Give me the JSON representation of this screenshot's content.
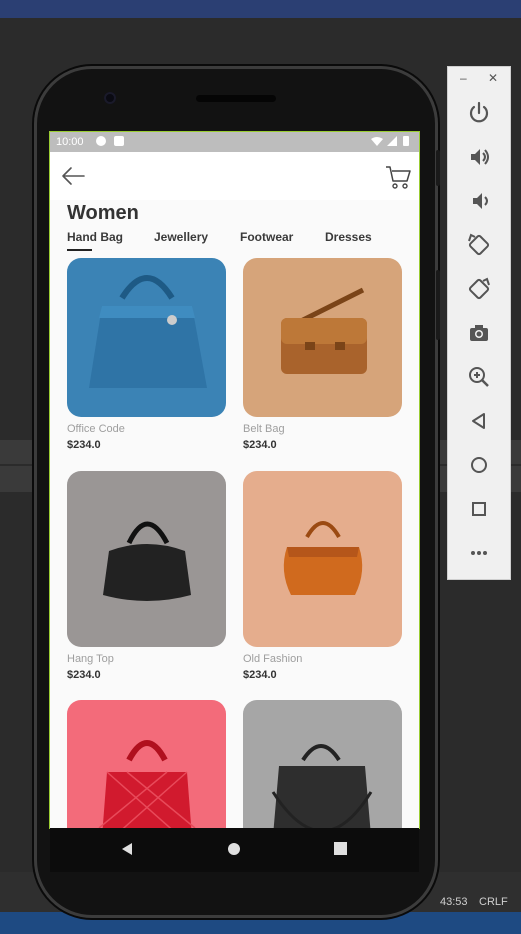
{
  "ide": {
    "status_position": "43:53",
    "status_eol": "CRLF"
  },
  "device": {
    "status_bar": {
      "time": "10:00"
    }
  },
  "app": {
    "title": "Women",
    "tabs": [
      {
        "label": "Hand Bag",
        "selected": true
      },
      {
        "label": "Jewellery",
        "selected": false
      },
      {
        "label": "Footwear",
        "selected": false
      },
      {
        "label": "Dresses",
        "selected": false
      }
    ],
    "products": [
      {
        "name": "Office Code",
        "price": "$234.0",
        "bg": "#3b83b5"
      },
      {
        "name": "Belt Bag",
        "price": "$234.0",
        "bg": "#d6a47a"
      },
      {
        "name": "Hang Top",
        "price": "$234.0",
        "bg": "#9a9695"
      },
      {
        "name": "Old Fashion",
        "price": "$234.0",
        "bg": "#e5ad8d"
      },
      {
        "name": "",
        "price": "",
        "bg": "#f36b7a"
      },
      {
        "name": "",
        "price": "",
        "bg": "#a6a6a6"
      }
    ]
  },
  "colors": {
    "accent": "#2b3f73",
    "screen_bg": "#fafafa",
    "text_dark": "#333333",
    "text_muted": "#9e9e9e"
  },
  "emulator_toolbar": {
    "icons": [
      "power-icon",
      "volume-up-icon",
      "volume-down-icon",
      "rotate-left-icon",
      "rotate-right-icon",
      "camera-icon",
      "zoom-icon",
      "back-icon",
      "home-icon",
      "overview-icon",
      "more-icon"
    ]
  }
}
